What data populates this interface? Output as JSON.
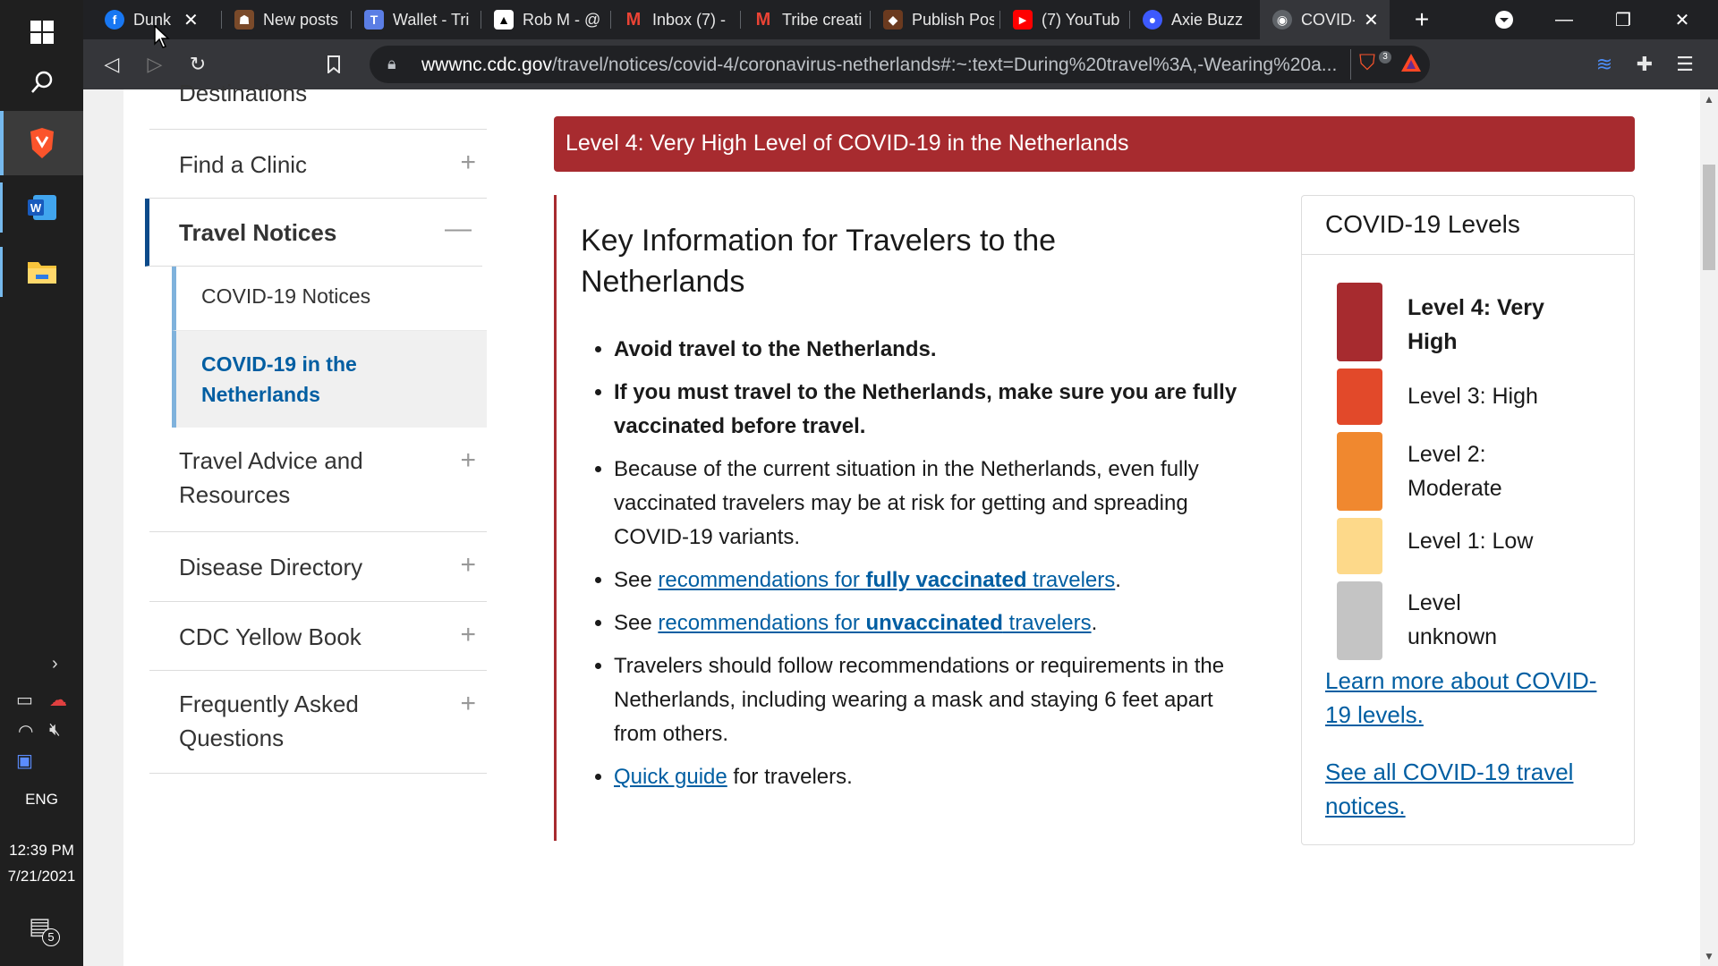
{
  "taskbar": {
    "language": "ENG",
    "time": "12:39 PM",
    "date": "7/21/2021",
    "notification_count": "5"
  },
  "browser": {
    "tabs": [
      {
        "title": "Dunk S",
        "fav_color": "#1877f2",
        "fav_glyph": "f"
      },
      {
        "title": "New posts",
        "fav_color": "#7a4a2a",
        "fav_glyph": "☗"
      },
      {
        "title": "Wallet - Tri",
        "fav_color": "#5b7ee5",
        "fav_glyph": "T"
      },
      {
        "title": "Rob M - @",
        "fav_color": "#ffffff",
        "fav_glyph": "▲"
      },
      {
        "title": "Inbox (7) -",
        "fav_color": "#ffffff",
        "fav_glyph": "M"
      },
      {
        "title": "Tribe creati",
        "fav_color": "#ffffff",
        "fav_glyph": "M"
      },
      {
        "title": "Publish Pos",
        "fav_color": "#6b3a1f",
        "fav_glyph": "◆"
      },
      {
        "title": "(7) YouTub",
        "fav_color": "#ff0000",
        "fav_glyph": "▶"
      },
      {
        "title": "Axie Buzz",
        "fav_color": "#3d5afe",
        "fav_glyph": "●"
      },
      {
        "title": "COVID-",
        "fav_color": "#5f6368",
        "fav_glyph": "◉"
      }
    ],
    "url_host": "wwwnc.cdc.gov",
    "url_rest": "/travel/notices/covid-4/coronavirus-netherlands#:~:text=During%20travel%3A,-Wearing%20a...",
    "shield_count": "3"
  },
  "nav": {
    "items": [
      {
        "label": "Destinations"
      },
      {
        "label": "Find a Clinic"
      },
      {
        "label": "Travel Notices"
      },
      {
        "label": "Travel Advice and Resources"
      },
      {
        "label": "Disease Directory"
      },
      {
        "label": "CDC Yellow Book"
      },
      {
        "label": "Frequently Asked Questions"
      }
    ],
    "sub_items": [
      {
        "label": "COVID-19 Notices"
      },
      {
        "label": "COVID-19 in the Netherlands"
      }
    ]
  },
  "banner": {
    "text": "Level 4: Very High Level of COVID-19 in the Netherlands"
  },
  "key_info": {
    "title": "Key Information for Travelers to the Netherlands",
    "b1": "Avoid travel to the Netherlands.",
    "b2": "If you must travel to the Netherlands, make sure you are fully vaccinated before travel.",
    "b3": "Because of the current situation in the Netherlands, even fully vaccinated travelers may be at risk for getting and spreading COVID-19 variants.",
    "see": "See",
    "b4_link_a": "recommendations for ",
    "b4_link_b": "fully vaccinated",
    "b4_link_c": " travelers",
    "b5_link_a": "recommendations for ",
    "b5_link_b": "unvaccinated",
    "b5_link_c": " travelers",
    "b6": "Travelers should follow recommendations or requirements in the Netherlands, including wearing a mask and staying 6 feet apart from others.",
    "b7_link": "Quick guide",
    "b7_rest": " for travelers.",
    "period": "."
  },
  "levels": {
    "title": "COVID-19 Levels",
    "items": [
      {
        "label": "Level 4: Very High",
        "color": "#a72b2f"
      },
      {
        "label": "Level 3: High",
        "color": "#e2492a"
      },
      {
        "label": "Level 2: Moderate",
        "color": "#f0882f"
      },
      {
        "label": "Level 1: Low",
        "color": "#fdd98a"
      },
      {
        "label": "Level unknown",
        "color": "#c4c4c4"
      }
    ],
    "learn_more": "Learn more about COVID-19 levels.",
    "see_all": "See all COVID-19 travel notices."
  }
}
